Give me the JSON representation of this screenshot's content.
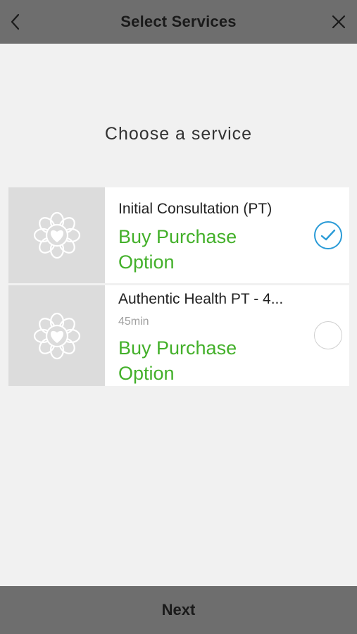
{
  "header": {
    "title": "Select Services",
    "back_icon": "chevron-left-icon",
    "close_icon": "close-icon"
  },
  "subtitle": "Choose a service",
  "services": [
    {
      "name": "Initial Consultation (PT)",
      "duration": "",
      "price_label_line1": "Buy Purchase",
      "price_label_line2": "Option",
      "selected": true,
      "thumbnail_icon": "heart-flower-logo-icon"
    },
    {
      "name": "Authentic Health PT - 4...",
      "duration": "45min",
      "price_label_line1": "Buy Purchase",
      "price_label_line2": "Option",
      "selected": false,
      "thumbnail_icon": "heart-flower-logo-icon"
    }
  ],
  "footer": {
    "next_label": "Next"
  },
  "colors": {
    "header_bg": "#6e6e6e",
    "price_green": "#43b02a",
    "check_blue": "#2a9bd7",
    "page_bg": "#f1f1f1"
  }
}
